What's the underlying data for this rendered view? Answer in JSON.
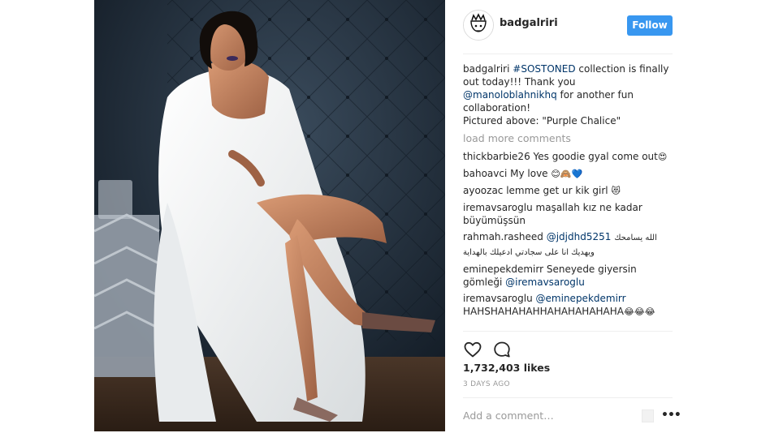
{
  "post": {
    "username": "badgalriri",
    "follow_label": "Follow",
    "photo_alt": "Fashion photo",
    "caption": {
      "user": "badgalriri",
      "hashtag": "#SOSTONED",
      "text1": " collection is finally out today!!! Thank you ",
      "mention": "@manoloblahnikhq",
      "text2": " for another fun collaboration!",
      "text3": "Pictured above: \"Purple Chalice\""
    },
    "load_more": "load more comments",
    "comments": [
      {
        "user": "thickbarbie26",
        "text": " Yes goodie gyal come out",
        "emoji": "😍"
      },
      {
        "user": "bahoavci",
        "text": " My love ",
        "emoji": "😊🙈💙"
      },
      {
        "user": "ayoozac",
        "text": " lemme get ur kik girl ",
        "emoji": "😻"
      },
      {
        "user": "iremavsaroglu",
        "text": " maşallah kız ne kadar büyümüşsün"
      },
      {
        "user": "rahmah.rasheed",
        "mention": "@jdjdhd5251",
        "text": "الله يسامحك ويهديك انا على سجادتي ادعيلك بالهداية"
      },
      {
        "user": "eminepekdemirr",
        "text": " Seneyede giyersin gömleği ",
        "mention": "@iremavsaroglu"
      },
      {
        "user": "iremavsaroglu",
        "mention": "@eminepekdemirr",
        "text": "HAHSHAHAHAHHAHAHAHAHAHA",
        "emoji": "😂😂😂"
      }
    ],
    "likes": "1,732,403 likes",
    "time": "3 DAYS AGO",
    "add_comment_placeholder": "Add a comment…",
    "more_label": "•••",
    "icons": [
      "heart-icon",
      "comment-icon",
      "more-options-icon"
    ],
    "colors": {
      "follow": "#3897f0",
      "link": "#003569",
      "muted": "#999999",
      "text": "#262626"
    }
  }
}
